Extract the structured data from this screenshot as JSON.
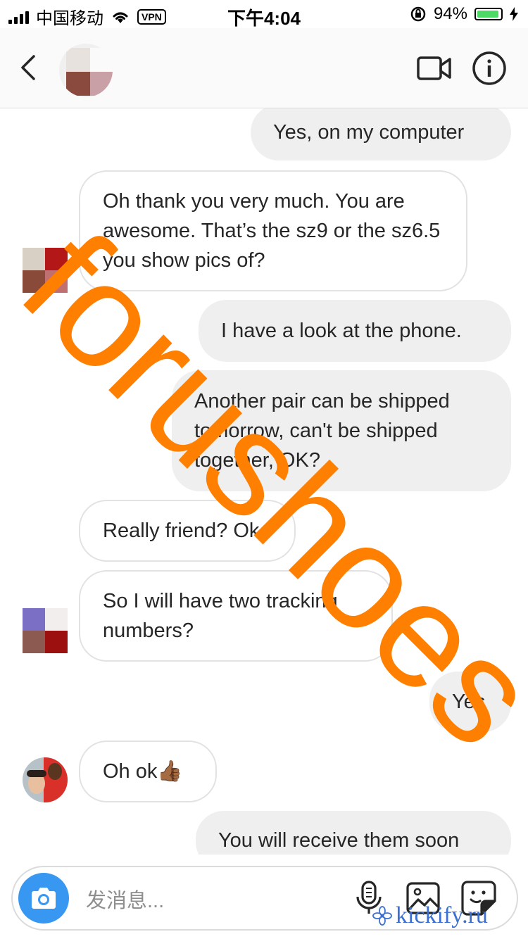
{
  "status_bar": {
    "carrier": "中国移动",
    "vpn_label": "VPN",
    "time": "下午4:04",
    "battery_percent_text": "94%",
    "battery_level": 0.94
  },
  "header": {
    "back_icon": "chevron-left-icon",
    "video_icon": "video-camera-icon",
    "info_icon": "info-icon"
  },
  "messages": [
    {
      "side": "out",
      "text": "Yes, on my computer"
    },
    {
      "side": "in",
      "text": "Oh thank you very much. You are awesome. That’s the sz9 or the sz6.5 you show pics of?"
    },
    {
      "side": "out",
      "text": "I have a look at the phone."
    },
    {
      "side": "out",
      "text": "Another pair can be shipped tomorrow, can't be shipped together, OK?"
    },
    {
      "side": "in",
      "text": "Really friend? Ok"
    },
    {
      "side": "in",
      "text": "So I will have two tracking numbers?"
    },
    {
      "side": "out",
      "text": "Yes"
    },
    {
      "side": "in",
      "text": "Oh ok👍🏾"
    },
    {
      "side": "out",
      "text": "You will receive them soon"
    }
  ],
  "composer": {
    "placeholder": "发消息...",
    "camera_icon": "camera-icon",
    "mic_icon": "microphone-icon",
    "photo_icon": "photo-gallery-icon",
    "sticker_icon": "sticker-icon"
  },
  "watermarks": {
    "main": "forushoes",
    "brand": "kickify.ru"
  },
  "colors": {
    "accent": "#3897f0",
    "watermark": "#ff7f00",
    "outgoing_bubble": "#efefef",
    "incoming_border": "#e2e2e2"
  }
}
